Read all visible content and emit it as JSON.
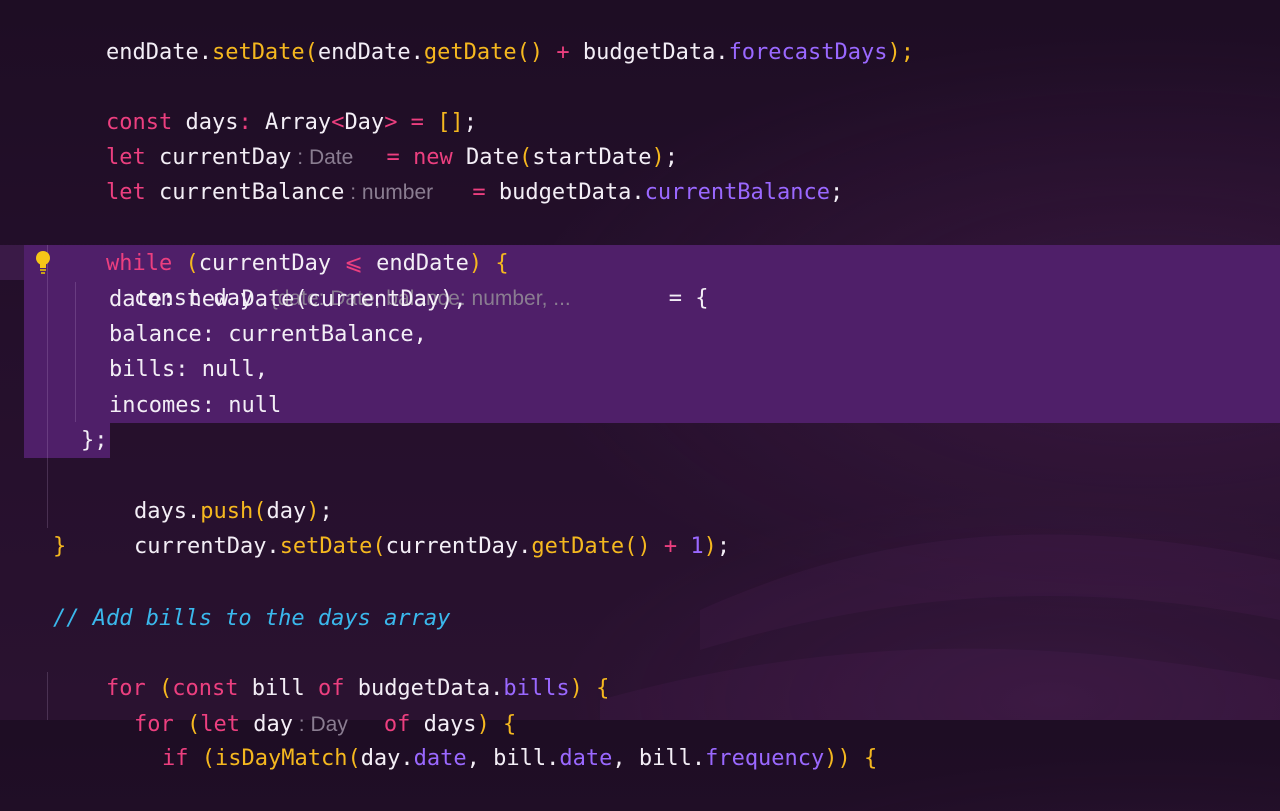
{
  "colors": {
    "background": "#221026",
    "selection": "#4f1f69",
    "keyword": "#ec3f7f",
    "function": "#f5b81f",
    "property": "#9a68ff",
    "comment": "#3ab8ec",
    "hint": "#8a7d91",
    "text": "#f3eef6"
  },
  "icons": {
    "lightbulb": "lightbulb-icon"
  },
  "code": {
    "l1": {
      "a": "endDate.",
      "b": "setDate",
      "c": "(",
      "d": "endDate.",
      "e": "getDate",
      "f": "()",
      "g": " + ",
      "h": "budgetData.",
      "i": "forecastDays",
      "j": ");"
    },
    "l3": {
      "a": "const",
      "b": " days",
      "c": ":",
      "d": " Array",
      "e": "<",
      "f": "Day",
      "g": ">",
      "h": " = ",
      "i": "[]",
      "j": ";"
    },
    "l4": {
      "a": "let",
      "b": " currentDay",
      "c": " : Date",
      "d": " = ",
      "e": "new",
      "f": " Date",
      "g": "(",
      "h": "startDate",
      "i": ")",
      "j": ";"
    },
    "l5": {
      "a": "let",
      "b": " currentBalance",
      "c": " : number",
      "d": " = ",
      "e": "budgetData.",
      "f": "currentBalance",
      "g": ";"
    },
    "l7": {
      "a": "while",
      "b": " (",
      "c": "currentDay",
      "d": " ⩽ ",
      "e": "endDate",
      "f": ")",
      "g": " {"
    },
    "l8": {
      "a": "const day",
      "b": " : {date: Date, balance: number, ...",
      "c": "= {"
    },
    "l9": "date: new Date(currentDay),",
    "l10": "balance: currentBalance,",
    "l11": "bills: null,",
    "l12": "incomes: null",
    "l13": "};",
    "l14": {
      "a": "days.",
      "b": "push",
      "c": "(",
      "d": "day",
      "e": ")",
      "f": ";"
    },
    "l15": {
      "a": "currentDay.",
      "b": "setDate",
      "c": "(",
      "d": "currentDay.",
      "e": "getDate",
      "f": "()",
      "g": " + ",
      "h": "1",
      "i": ")",
      "j": ";"
    },
    "l16": "}",
    "l18": "// Add bills to the days array",
    "l19": {
      "a": "for",
      "b": " (",
      "c": "const",
      "d": " bill ",
      "e": "of",
      "f": " budgetData.",
      "g": "bills",
      "h": ")",
      "i": " {"
    },
    "l20": {
      "a": "for",
      "b": " (",
      "c": "let",
      "d": " day",
      "e": " : Day",
      "f": "of",
      "g": " days",
      "h": ")",
      "i": " {"
    },
    "l21": {
      "a": "if",
      "b": " (",
      "c": "isDayMatch",
      "d": "(",
      "e": "day.",
      "f": "date",
      "g": ", bill.",
      "h": "date",
      "i": ", bill.",
      "j": "frequency",
      "k": "))",
      "l": " {"
    }
  }
}
